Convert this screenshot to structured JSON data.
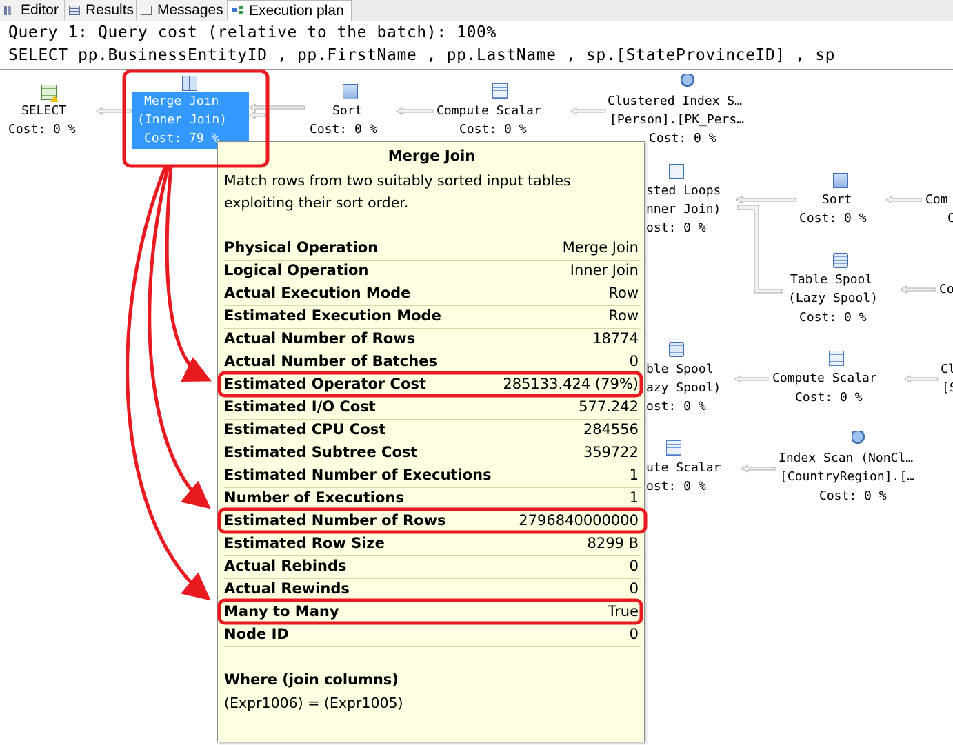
{
  "tabs": [
    {
      "label": "Editor",
      "icon": "editor-icon"
    },
    {
      "label": "Results",
      "icon": "results-grid-icon"
    },
    {
      "label": "Messages",
      "icon": "messages-icon"
    },
    {
      "label": "Execution plan",
      "icon": "execution-plan-icon"
    }
  ],
  "query": {
    "header": "Query 1: Query cost (relative to the batch): 100%",
    "sql": "SELECT pp.BusinessEntityID , pp.FirstName , pp.LastName , sp.[StateProvinceID] , sp"
  },
  "plan": {
    "select": {
      "name": "SELECT",
      "cost": "Cost: 0 %"
    },
    "merge_join": {
      "name": "Merge Join",
      "sub": "(Inner Join)",
      "cost": "Cost: 79 %"
    },
    "sort1": {
      "name": "Sort",
      "cost": "Cost: 0 %"
    },
    "compute1": {
      "name": "Compute Scalar",
      "cost": "Cost: 0 %"
    },
    "clustered_index": {
      "name": "Clustered Index S…",
      "sub": "[Person].[PK_Pers…",
      "cost": "Cost: 0 %"
    },
    "nested_loops": {
      "name": "sted Loops",
      "sub": "nner Join)",
      "cost": "ost: 0 %"
    },
    "sort2": {
      "name": "Sort",
      "cost": "Cost: 0 %"
    },
    "comp_partial": {
      "name": "Com",
      "sub": "C"
    },
    "table_spool1": {
      "name": "Table Spool",
      "sub": "(Lazy Spool)",
      "cost": "Cost: 0 %"
    },
    "co_partial": {
      "name": "Co"
    },
    "table_spool2": {
      "name": "ble Spool",
      "sub": "azy Spool)",
      "cost": "ost: 0 %"
    },
    "compute2": {
      "name": "Compute Scalar",
      "cost": "Cost: 0 %"
    },
    "cl_partial": {
      "name": "Cl",
      "sub": "[S"
    },
    "compute3": {
      "name": "ute Scalar",
      "cost": "ost: 0 %"
    },
    "index_scan": {
      "name": "Index Scan (NonCl…",
      "sub": "[CountryRegion].[…",
      "cost": "Cost: 0 %"
    }
  },
  "tooltip": {
    "title": "Merge Join",
    "description": "Match rows from two suitably sorted input tables exploiting their sort order.",
    "rows": [
      {
        "key": "Physical Operation",
        "value": "Merge Join"
      },
      {
        "key": "Logical Operation",
        "value": "Inner Join"
      },
      {
        "key": "Actual Execution Mode",
        "value": "Row"
      },
      {
        "key": "Estimated Execution Mode",
        "value": "Row"
      },
      {
        "key": "Actual Number of Rows",
        "value": "18774"
      },
      {
        "key": "Actual Number of Batches",
        "value": "0"
      },
      {
        "key": "Estimated Operator Cost",
        "value": "285133.424 (79%)"
      },
      {
        "key": "Estimated I/O Cost",
        "value": "577.242"
      },
      {
        "key": "Estimated CPU Cost",
        "value": "284556"
      },
      {
        "key": "Estimated Subtree Cost",
        "value": "359722"
      },
      {
        "key": "Estimated Number of Executions",
        "value": "1"
      },
      {
        "key": "Number of Executions",
        "value": "1"
      },
      {
        "key": "Estimated Number of Rows",
        "value": "2796840000000"
      },
      {
        "key": "Estimated Row Size",
        "value": "8299 B"
      },
      {
        "key": "Actual Rebinds",
        "value": "0"
      },
      {
        "key": "Actual Rewinds",
        "value": "0"
      },
      {
        "key": "Many to Many",
        "value": "True"
      },
      {
        "key": "Node ID",
        "value": "0"
      }
    ],
    "where_label": "Where (join columns)",
    "where_expr": "(Expr1006) = (Expr1005)"
  },
  "colors": {
    "annotation_red": "#e8191f",
    "selection_blue": "#3399ff",
    "tooltip_bg": "#ffffe1"
  }
}
